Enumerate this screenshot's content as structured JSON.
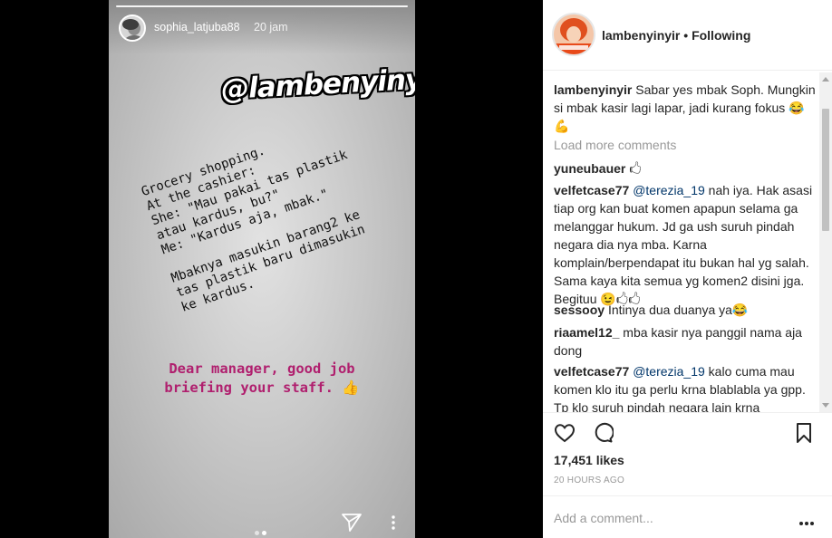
{
  "story": {
    "username": "sophia_latjuba88",
    "time": "20 jam",
    "tag_text": "@lambenyinyir",
    "typed_lines_1": [
      "Grocery shopping.",
      "At the cashier:",
      "She: \"Mau pakai tas plastik",
      "atau kardus, bu?\"",
      "Me: \"Kardus aja, mbak.\""
    ],
    "typed_lines_2": [
      "Mbaknya masukin barang2 ke",
      "tas plastik baru dimasukin",
      "ke kardus."
    ],
    "pink_lines": [
      "Dear manager, good job",
      "briefing your staff. 👍"
    ],
    "icons": {
      "send": "send-icon",
      "more": "more-vertical-icon"
    }
  },
  "post": {
    "username": "lambenyinyir",
    "separator": "•",
    "follow_status": "Following",
    "load_more": "Load more comments",
    "comments": [
      {
        "user": "lambenyinyir",
        "mention": "",
        "text": "Sabar yes mbak Soph. Mungkin si mbak kasir lagi lapar, jadi kurang fokus 😂💪"
      },
      {
        "user": "yuneubauer",
        "mention": "",
        "text": "🖒"
      },
      {
        "user": "velfetcase77",
        "mention": "@terezia_19",
        "text": "nah iya. Hak asasi tiap org kan buat komen apapun selama ga melanggar hukum. Jd ga ush suruh pindah negara dia nya mba. Karna komplain/berpendapat itu bukan hal yg salah. Sama kaya kita semua yg komen2 disini jga. Begituu 😉🖒🖒"
      },
      {
        "user": "sessooy",
        "mention": "",
        "text": "Intinya dua duanya ya😂"
      },
      {
        "user": "riaamel12_",
        "mention": "",
        "text": "mba kasir nya panggil nama aja dong"
      },
      {
        "user": "velfetcase77",
        "mention": "@terezia_19",
        "text": "kalo cuma mau komen klo itu ga perlu krna blablabla ya gpp. Tp klo suruh pindah negara lain krna"
      }
    ],
    "likes": "17,451 likes",
    "time": "20 HOURS AGO",
    "add_comment_placeholder": "Add a comment...",
    "icons": {
      "like": "heart-icon",
      "comment": "comment-icon",
      "save": "bookmark-icon",
      "options": "more-horizontal-icon"
    }
  }
}
